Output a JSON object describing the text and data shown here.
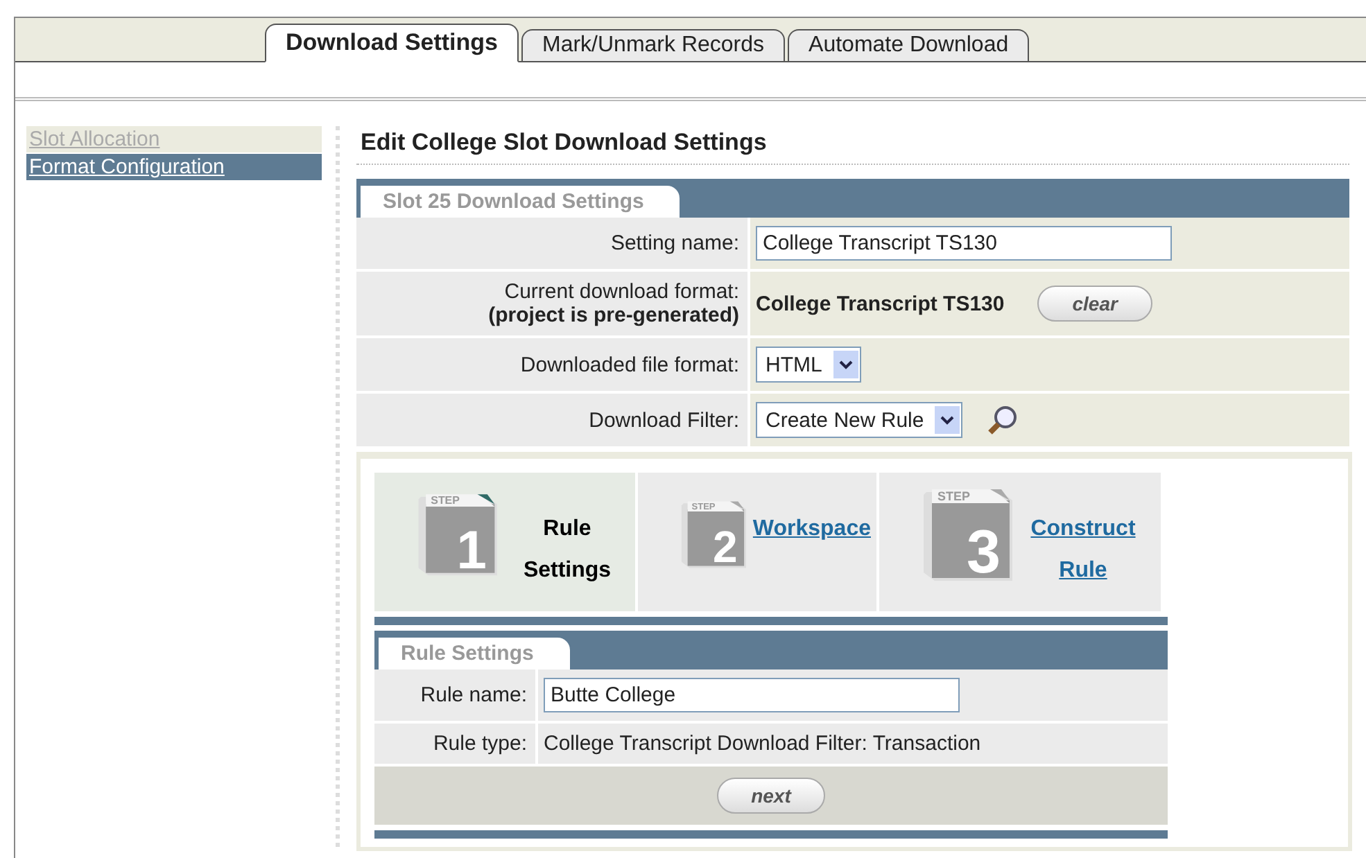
{
  "tabs": [
    {
      "label": "Download Settings",
      "selected": true
    },
    {
      "label": "Mark/Unmark Records",
      "selected": false
    },
    {
      "label": "Automate Download",
      "selected": false
    }
  ],
  "sidebar": {
    "items": [
      {
        "label": "Slot Allocation",
        "selected": false
      },
      {
        "label": "Format Configuration",
        "selected": true
      }
    ]
  },
  "page_title": "Edit College Slot Download Settings",
  "settings_panel": {
    "title": "Slot 25 Download Settings",
    "rows": [
      {
        "kind": "input",
        "label": "Setting name:",
        "value": "College Transcript TS130"
      },
      {
        "kind": "readonly",
        "label": "Current download format:",
        "note": "(project is pre-generated)",
        "value": "College Transcript TS130",
        "button": "clear"
      },
      {
        "kind": "select",
        "label": "Downloaded file format:",
        "value": "HTML"
      },
      {
        "kind": "select",
        "label": "Download Filter:",
        "value": "Create New Rule",
        "search": true
      }
    ]
  },
  "steps": [
    {
      "tag": "STEP",
      "number": "1",
      "label": "Rule Settings",
      "selected": true
    },
    {
      "tag": "STEP",
      "number": "2",
      "label": "Workspace",
      "selected": false
    },
    {
      "tag": "STEP",
      "number": "3",
      "label": "Construct Rule",
      "selected": false
    }
  ],
  "rule_panel": {
    "title": "Rule Settings",
    "rows": [
      {
        "kind": "input",
        "label": "Rule name:",
        "value": "Butte College"
      },
      {
        "kind": "text",
        "label": "Rule type:",
        "value": "College Transcript Download Filter: Transaction"
      }
    ],
    "button": "next"
  }
}
